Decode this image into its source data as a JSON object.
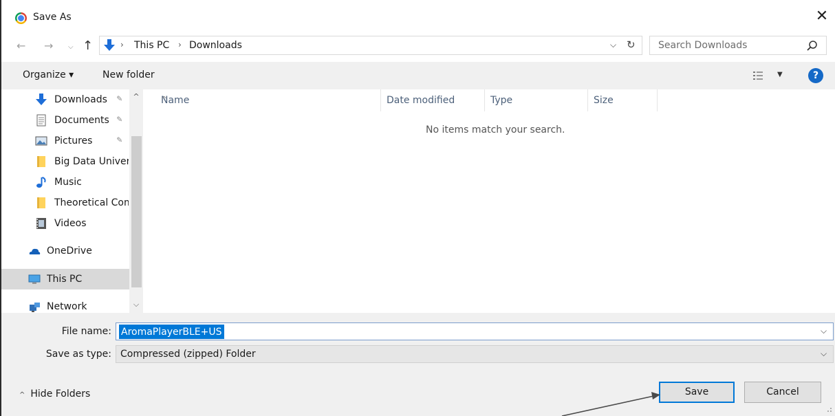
{
  "window": {
    "title": "Save As",
    "close_glyph": "✕",
    "app_icon": "chrome-icon"
  },
  "navigation": {
    "back_glyph": "←",
    "forward_glyph": "→",
    "history_glyph": "⌵",
    "up_glyph": "↑",
    "breadcrumb": [
      "This PC",
      "Downloads"
    ],
    "breadcrumb_separator": "›",
    "dropdown_glyph": "⌵",
    "refresh_glyph": "↻",
    "search_placeholder": "Search Downloads"
  },
  "commandbar": {
    "organize_label": "Organize ▾",
    "new_folder_label": "New folder",
    "view_caret": "▼",
    "help_label": "?"
  },
  "sidebar": {
    "items": [
      {
        "label": "Downloads",
        "icon": "downloads-icon",
        "pinned": true
      },
      {
        "label": "Documents",
        "icon": "documents-icon",
        "pinned": true
      },
      {
        "label": "Pictures",
        "icon": "pictures-icon",
        "pinned": true
      },
      {
        "label": "Big Data Univers",
        "icon": "folder-icon",
        "pinned": false
      },
      {
        "label": "Music",
        "icon": "music-icon",
        "pinned": false
      },
      {
        "label": "Theoretical Com",
        "icon": "folder-icon",
        "pinned": false
      },
      {
        "label": "Videos",
        "icon": "videos-icon",
        "pinned": false
      },
      {
        "label": "OneDrive",
        "icon": "onedrive-icon",
        "pinned": false
      },
      {
        "label": "This PC",
        "icon": "this-pc-icon",
        "pinned": false,
        "selected": true
      },
      {
        "label": "Network",
        "icon": "network-icon",
        "pinned": false
      }
    ],
    "pin_glyph": "📌",
    "scroll_up_glyph": "^",
    "scroll_down_glyph": "⌵"
  },
  "filelist": {
    "columns": [
      "Name",
      "Date modified",
      "Type",
      "Size"
    ],
    "sort_glyph": "^",
    "empty_message": "No items match your search."
  },
  "form": {
    "file_name_label": "File name:",
    "file_name_value": "AromaPlayerBLE+USB",
    "save_type_label": "Save as type:",
    "save_type_value": "Compressed (zipped) Folder",
    "dropdown_glyph": "⌵",
    "hide_folders_label": "Hide Folders",
    "hide_folders_glyph": "^",
    "save_label": "Save",
    "cancel_label": "Cancel"
  },
  "colors": {
    "accent": "#0078d7",
    "selection": "#d9d9d9",
    "chrome_bg": "#f0f0f0",
    "column_header_text": "#4c607a"
  }
}
